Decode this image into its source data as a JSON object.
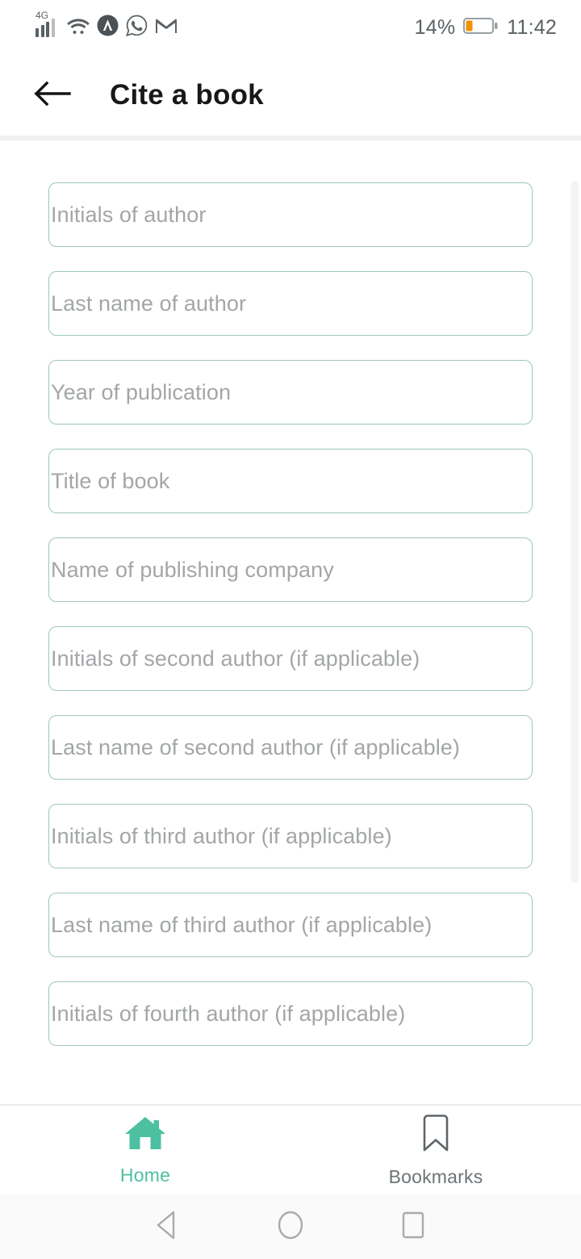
{
  "status_bar": {
    "network_type": "4G",
    "battery_percent": "14%",
    "time": "11:42",
    "icons": [
      "signal-icon",
      "wifi-icon",
      "avast-icon",
      "whatsapp-icon",
      "gmail-icon"
    ]
  },
  "app_bar": {
    "back_icon": "back-arrow-icon",
    "title": "Cite a book"
  },
  "form": {
    "fields": [
      {
        "placeholder": "Initials of author",
        "value": ""
      },
      {
        "placeholder": "Last name of author",
        "value": ""
      },
      {
        "placeholder": "Year of publication",
        "value": ""
      },
      {
        "placeholder": "Title of book",
        "value": ""
      },
      {
        "placeholder": "Name of publishing company",
        "value": ""
      },
      {
        "placeholder": "Initials of second author (if applicable)",
        "value": ""
      },
      {
        "placeholder": "Last name of second author (if applicable)",
        "value": ""
      },
      {
        "placeholder": "Initials of third author (if applicable)",
        "value": ""
      },
      {
        "placeholder": "Last name of third author (if applicable)",
        "value": ""
      },
      {
        "placeholder": "Initials of fourth author (if applicable)",
        "value": ""
      }
    ]
  },
  "bottom_nav": {
    "items": [
      {
        "label": "Home",
        "icon": "home-icon",
        "active": true
      },
      {
        "label": "Bookmarks",
        "icon": "bookmark-icon",
        "active": false
      }
    ]
  },
  "android_nav": {
    "back": "triangle-back-icon",
    "home": "circle-home-icon",
    "recents": "square-recents-icon"
  },
  "colors": {
    "accent": "#4cc0a0",
    "field_border": "#9ec7b9",
    "placeholder": "#a3a6a8",
    "title": "#16181a",
    "inactive_nav": "#6d7376",
    "battery": "#f29100"
  }
}
